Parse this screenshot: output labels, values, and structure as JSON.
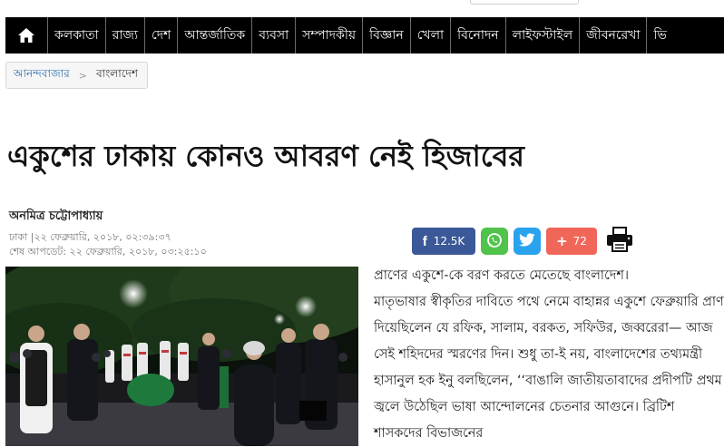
{
  "nav": {
    "home_icon": "home-icon",
    "items": [
      "কলকাতা",
      "রাজ্য",
      "দেশ",
      "আন্তর্জাতিক",
      "ব্যবসা",
      "সম্পাদকীয়",
      "বিজ্ঞান",
      "খেলা",
      "বিনোদন",
      "লাইফস্টাইল",
      "জীবনরেখা",
      "ভি"
    ]
  },
  "breadcrumb": {
    "home": "আনন্দবাজার",
    "separator": ">",
    "current": "বাংলাদেশ"
  },
  "article": {
    "headline": "একুশের ঢাকায় কোনও আবরণ নেই হিজাবের",
    "author": "অনমিত্র চট্টোপাধ্যায়",
    "dateline": "ঢাকা |২২ ফেব্রুয়ারি, ২০১৮, ০২:৩৯:৩৭",
    "updated": "শেষ আপডেট: ২২ ফেব্রুয়ারি, ২০১৮, ০৩:২৫:১০",
    "paragraphs": [
      "প্রাণের একুশে-কে বরণ করতে মেতেছে বাংলাদেশ।",
      "মাতৃভাষার স্বীকৃতির দাবিতে পথে নেমে বাহান্নর একুশে ফেব্রুয়ারি প্রাণ দিয়েছিলেন যে রফিক, সালাম, বরকত, সফিউর, জব্বরেরা— আজ সেই শহিদদের স্মরণের দিন। শুধু তা-ই নয়, বাংলাদেশের তথ্যমন্ত্রী হাসানুল হক ইনু বলছিলেন, ‘‘বাঙালি জাতীয়তাবাদের প্রদীপটি প্রথম জ্বলে উঠেছিল ভাষা আন্দোলনের চেতনার আগুনে। ব্রিটিশ শাসকদের বিভাজনের"
    ]
  },
  "share": {
    "facebook_label": "f",
    "facebook_count": "12.5K",
    "plus_label": "+",
    "plus_count": "72",
    "icons": [
      "facebook-icon",
      "whatsapp-icon",
      "twitter-icon",
      "share-plus-icon",
      "print-icon"
    ]
  },
  "colors": {
    "nav_bg": "#000000",
    "facebook": "#3b5998",
    "whatsapp": "#4fc34a",
    "twitter": "#2aa3ef",
    "plus": "#f0675a",
    "link": "#2b6cb0"
  }
}
